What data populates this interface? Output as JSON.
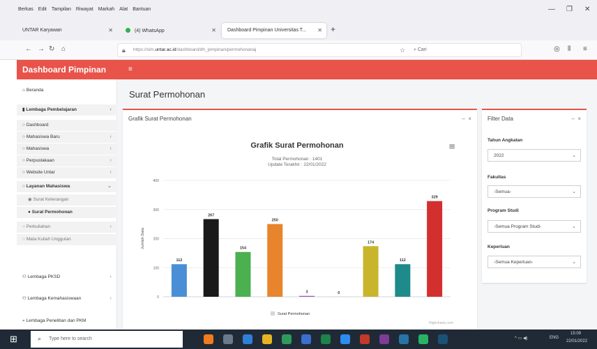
{
  "browser": {
    "menu": [
      "Berkas",
      "Edit",
      "Tampilan",
      "Riwayat",
      "Markah",
      "Alat",
      "Bantuan"
    ],
    "tabs": [
      {
        "label": "UNTAR Karyawan",
        "active": false
      },
      {
        "label": "(4) WhatsApp",
        "active": false
      },
      {
        "label": "Dashboard Pimpinan Universitas T...",
        "active": true
      }
    ],
    "url_prefix": "https://sim.",
    "url_domain": "untar.ac.id",
    "url_path": "/dashboard/dh_pimpinan/permohonanaj",
    "search_label": "Cari"
  },
  "app": {
    "brand": "Dashboard Pimpinan",
    "colors": {
      "accent": "#e8534a"
    }
  },
  "sidebar": {
    "items": [
      {
        "label": "Beranda",
        "icon": "home-icon",
        "chevron": ""
      },
      {
        "label": "Lembaga Pembelajaran",
        "icon": "book-icon",
        "chevron": "‹"
      },
      {
        "label": "Dashboard",
        "icon": "circle-icon",
        "chevron": ""
      },
      {
        "label": "Mahasiswa Baru",
        "icon": "circle-icon",
        "chevron": "‹"
      },
      {
        "label": "Mahasiswa",
        "icon": "circle-icon",
        "chevron": "‹"
      },
      {
        "label": "Perpustakaan",
        "icon": "circle-icon",
        "chevron": "‹"
      },
      {
        "label": "Website Untar",
        "icon": "circle-icon",
        "chevron": "‹"
      },
      {
        "label": "Layanan Mahasiswa",
        "icon": "circle-icon",
        "chevron": "⌄"
      },
      {
        "label": "Surat Keterangan",
        "icon": "dot-icon",
        "chevron": ""
      },
      {
        "label": "Surat Permohonan",
        "icon": "dot-icon",
        "chevron": ""
      },
      {
        "label": "Perkuliahan",
        "icon": "circle-icon",
        "chevron": "‹"
      },
      {
        "label": "Mata Kuliah Unggulan",
        "icon": "circle-icon",
        "chevron": ""
      },
      {
        "label": "Lembaga PKSD",
        "icon": "users-icon",
        "chevron": "‹"
      },
      {
        "label": "Lembaga Kemahasiswaan",
        "icon": "users-icon",
        "chevron": "‹"
      },
      {
        "label": "Lembaga Penelitian dan PKM",
        "icon": "search-icon",
        "chevron": ""
      }
    ]
  },
  "page": {
    "title": "Surat Permohonan",
    "chart_card_title": "Grafik Surat Permohonan",
    "credit": "Highcharts.com"
  },
  "filter": {
    "title": "Filter Data",
    "fields": [
      {
        "label": "Tahun Angkatan",
        "value": "2022"
      },
      {
        "label": "Fakultas",
        "value": "-Semua-"
      },
      {
        "label": "Program Studi",
        "value": "-Semua Program Studi-"
      },
      {
        "label": "Keperluan",
        "value": "-Semua Keperluan-"
      }
    ]
  },
  "chart_data": {
    "type": "bar",
    "title": "Grafik Surat Permohonan",
    "subtitle": "Total Permohonan : 1401",
    "subtitle2": "Update Terakhir : 22/01/2022",
    "ylabel": "Jumlah Data",
    "ylim": [
      0,
      400
    ],
    "yticks": [
      0,
      100,
      200,
      300,
      400
    ],
    "series": [
      {
        "name": "Surat Permohonan",
        "values": [
          112,
          267,
          154,
          250,
          3,
          0,
          174,
          112,
          329
        ]
      }
    ],
    "bar_colors": [
      "#4a8fd6",
      "#1a1a1a",
      "#4caf50",
      "#e8842b",
      "#9b59b6",
      "#d6d6d6",
      "#c9b52c",
      "#1f8a8a",
      "#d32f2f"
    ]
  },
  "taskbar": {
    "search_placeholder": "Type here to search",
    "time": "15:09",
    "date": "22/01/2022",
    "lang": "ENG"
  }
}
